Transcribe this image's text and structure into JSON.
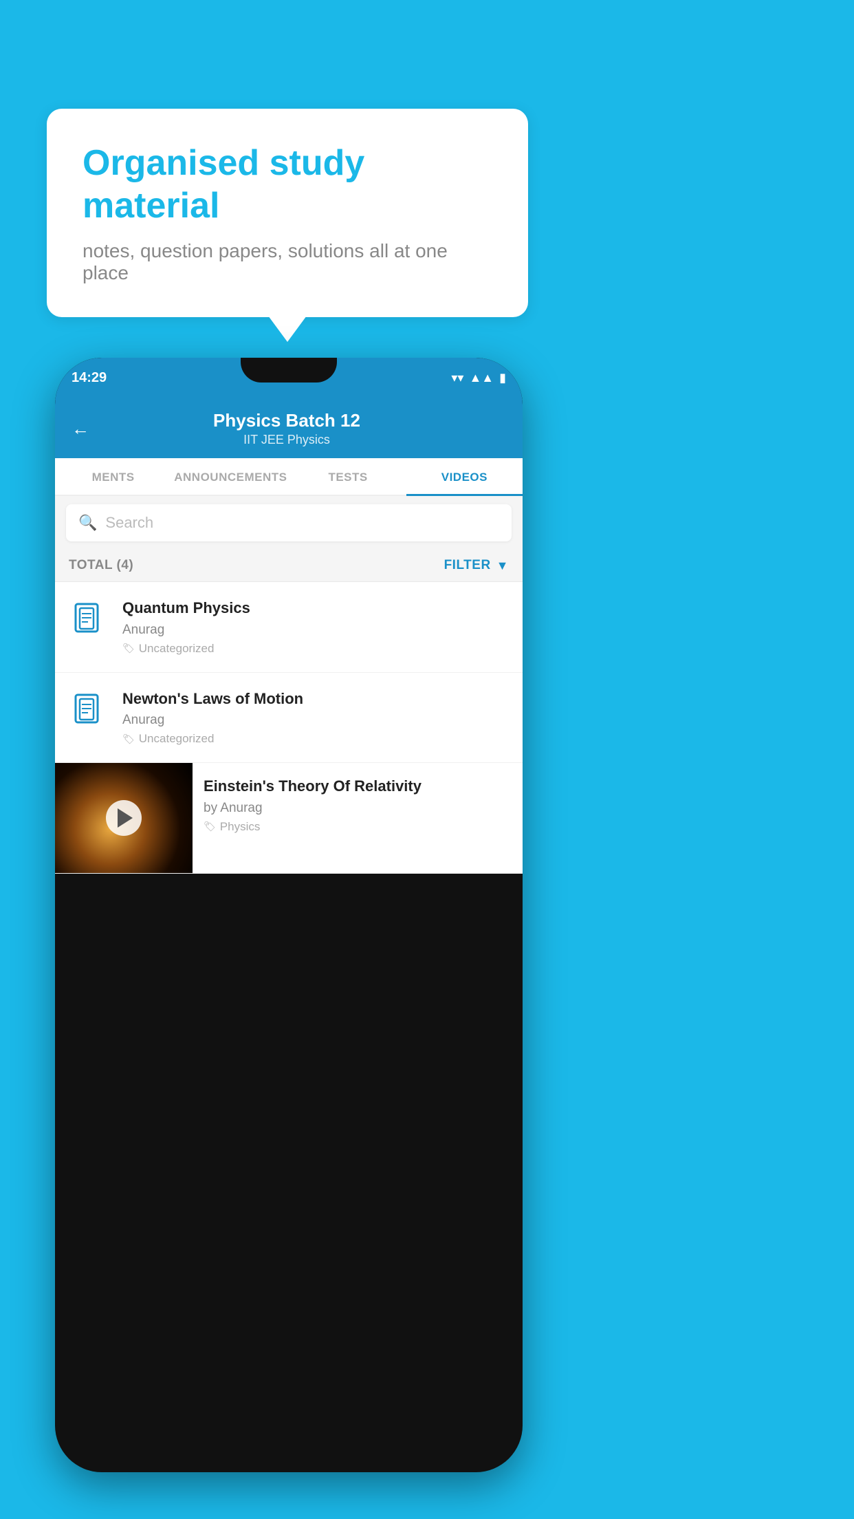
{
  "background": {
    "color": "#1bb8e8"
  },
  "bubble": {
    "title": "Organised study material",
    "subtitle": "notes, question papers, solutions all at one place"
  },
  "phone": {
    "status": {
      "time": "14:29"
    },
    "header": {
      "title": "Physics Batch 12",
      "subtitle": "IIT JEE   Physics",
      "back_label": "←"
    },
    "tabs": [
      {
        "label": "MENTS",
        "active": false
      },
      {
        "label": "ANNOUNCEMENTS",
        "active": false
      },
      {
        "label": "TESTS",
        "active": false
      },
      {
        "label": "VIDEOS",
        "active": true
      }
    ],
    "search": {
      "placeholder": "Search"
    },
    "filter": {
      "total_label": "TOTAL (4)",
      "filter_label": "FILTER"
    },
    "videos": [
      {
        "id": 1,
        "title": "Quantum Physics",
        "author": "Anurag",
        "tag": "Uncategorized",
        "has_thumb": false
      },
      {
        "id": 2,
        "title": "Newton's Laws of Motion",
        "author": "Anurag",
        "tag": "Uncategorized",
        "has_thumb": false
      },
      {
        "id": 3,
        "title": "Einstein's Theory Of Relativity",
        "author": "by Anurag",
        "tag": "Physics",
        "has_thumb": true
      }
    ]
  }
}
